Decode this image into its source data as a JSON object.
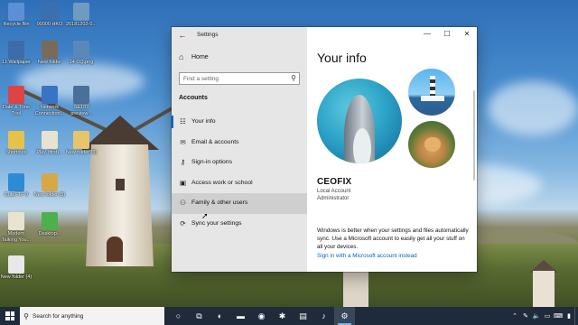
{
  "desktop": {
    "icons": [
      {
        "label": "Recycle Bin",
        "icon": "recycle-bin-icon",
        "color": "#5b8fd6"
      },
      {
        "label": "00000 HKO",
        "icon": "file-icon",
        "color": "#3a6fb0"
      },
      {
        "label": "20181202-0...",
        "icon": "image-icon",
        "color": "#6e9bc0"
      },
      {
        "label": "11 Wallpaper",
        "icon": "image-icon",
        "color": "#3d6da8"
      },
      {
        "label": "New folder",
        "icon": "image-icon",
        "color": "#7a6a5a"
      },
      {
        "label": "14 CQ.png",
        "icon": "image-icon",
        "color": "#5a88b8"
      },
      {
        "label": "Date & Time Tool",
        "icon": "calendar-icon",
        "color": "#d44"
      },
      {
        "label": "Network Connection...",
        "icon": "network-icon",
        "color": "#3a72c4"
      },
      {
        "label": "SE183 preview...",
        "icon": "image-icon",
        "color": "#4a6f99"
      },
      {
        "label": "Shortcuts",
        "icon": "music-file-icon",
        "color": "#e5c24a"
      },
      {
        "label": "Play (first)...",
        "icon": "music-file-icon",
        "color": "#e8e3d0"
      },
      {
        "label": "New folder (3)",
        "icon": "folder-icon",
        "color": "#e8c46a"
      },
      {
        "label": "CuteFTP 9",
        "icon": "ftp-icon",
        "color": "#2e8bd6"
      },
      {
        "label": "New folder (5)",
        "icon": "folder-icon",
        "color": "#d6a84a"
      },
      {
        "label": "Modern Talking You...",
        "icon": "music-file-icon",
        "color": "#e8e3d0"
      },
      {
        "label": "Desktop...",
        "icon": "gear-icon",
        "color": "#4cb04c"
      },
      {
        "label": "New folder (4)",
        "icon": "file-icon",
        "color": "#e8e8e8"
      }
    ]
  },
  "window": {
    "title": "Settings",
    "back": "←",
    "controls": {
      "minimize": "—",
      "maximize": "☐",
      "close": "✕"
    },
    "sidebar": {
      "home_label": "Home",
      "search_placeholder": "Find a setting",
      "section_title": "Accounts",
      "items": [
        {
          "label": "Your info",
          "icon": "person-card-icon",
          "glyph": "☷"
        },
        {
          "label": "Email & accounts",
          "icon": "email-icon",
          "glyph": "✉"
        },
        {
          "label": "Sign-in options",
          "icon": "key-icon",
          "glyph": "⚷"
        },
        {
          "label": "Access work or school",
          "icon": "briefcase-icon",
          "glyph": "▣"
        },
        {
          "label": "Family & other users",
          "icon": "person-add-icon",
          "glyph": "⚇"
        },
        {
          "label": "Sync your settings",
          "icon": "sync-icon",
          "glyph": "⟳"
        }
      ]
    },
    "content": {
      "title": "Your info",
      "account_name": "CEOFIX",
      "account_type": "Local Account",
      "account_role": "Administrator",
      "description": "Windows is better when your settings and files automatically sync. Use a Microsoft account to easily get all your stuff on all your devices.",
      "link": "Sign in with a Microsoft account instead"
    }
  },
  "taskbar": {
    "search_placeholder": "Search for anything",
    "apps": [
      {
        "name": "cortana",
        "icon": "cortana-icon",
        "glyph": "○"
      },
      {
        "name": "task-view",
        "icon": "task-view-icon",
        "glyph": "⧉"
      },
      {
        "name": "edge",
        "icon": "edge-icon",
        "glyph": "◐"
      },
      {
        "name": "file-explorer",
        "icon": "folder-icon",
        "glyph": "▬"
      },
      {
        "name": "chrome",
        "icon": "chrome-icon",
        "glyph": "◉"
      },
      {
        "name": "app",
        "icon": "app-icon",
        "glyph": "✱"
      },
      {
        "name": "store",
        "icon": "store-icon",
        "glyph": "▤"
      },
      {
        "name": "winamp",
        "icon": "winamp-icon",
        "glyph": "♪"
      },
      {
        "name": "settings",
        "icon": "gear-icon",
        "glyph": "⚙"
      }
    ],
    "tray": [
      "⌃",
      "✎",
      "🔈",
      "▭",
      "⌨",
      "▮"
    ]
  }
}
